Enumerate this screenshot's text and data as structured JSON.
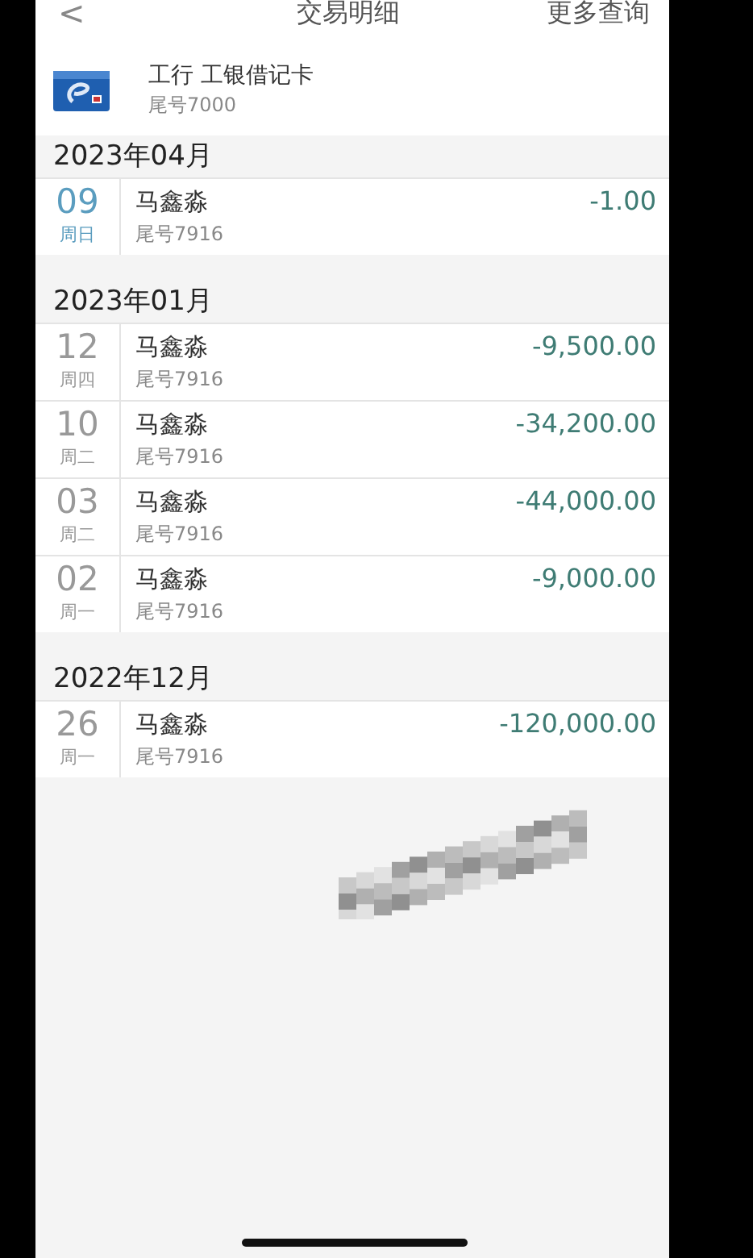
{
  "header": {
    "back": "<",
    "title": "交易明细",
    "action": "更多查询"
  },
  "account": {
    "name": "工行 工银借记卡",
    "number": "尾号7000"
  },
  "sections": [
    {
      "month": "2023年04月",
      "transactions": [
        {
          "day": "09",
          "weekday": "周日",
          "name": "马鑫淼",
          "number": "尾号7916",
          "amount": "-1.00",
          "highlighted": true
        }
      ]
    },
    {
      "month": "2023年01月",
      "transactions": [
        {
          "day": "12",
          "weekday": "周四",
          "name": "马鑫淼",
          "number": "尾号7916",
          "amount": "-9,500.00",
          "highlighted": false
        },
        {
          "day": "10",
          "weekday": "周二",
          "name": "马鑫淼",
          "number": "尾号7916",
          "amount": "-34,200.00",
          "highlighted": false
        },
        {
          "day": "03",
          "weekday": "周二",
          "name": "马鑫淼",
          "number": "尾号7916",
          "amount": "-44,000.00",
          "highlighted": false
        },
        {
          "day": "02",
          "weekday": "周一",
          "name": "马鑫淼",
          "number": "尾号7916",
          "amount": "-9,000.00",
          "highlighted": false
        }
      ]
    },
    {
      "month": "2022年12月",
      "transactions": [
        {
          "day": "26",
          "weekday": "周一",
          "name": "马鑫淼",
          "number": "尾号7916",
          "amount": "-120,000.00",
          "highlighted": false
        }
      ]
    }
  ]
}
